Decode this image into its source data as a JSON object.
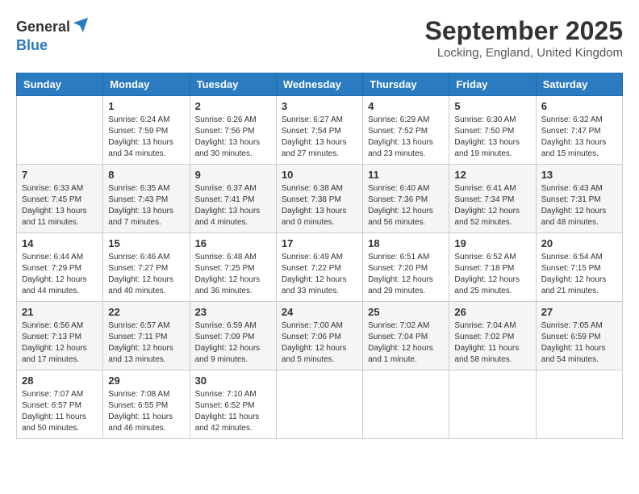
{
  "logo": {
    "general": "General",
    "blue": "Blue"
  },
  "title": "September 2025",
  "location": "Locking, England, United Kingdom",
  "weekdays": [
    "Sunday",
    "Monday",
    "Tuesday",
    "Wednesday",
    "Thursday",
    "Friday",
    "Saturday"
  ],
  "weeks": [
    [
      {
        "date": "",
        "info": ""
      },
      {
        "date": "1",
        "info": "Sunrise: 6:24 AM\nSunset: 7:59 PM\nDaylight: 13 hours\nand 34 minutes."
      },
      {
        "date": "2",
        "info": "Sunrise: 6:26 AM\nSunset: 7:56 PM\nDaylight: 13 hours\nand 30 minutes."
      },
      {
        "date": "3",
        "info": "Sunrise: 6:27 AM\nSunset: 7:54 PM\nDaylight: 13 hours\nand 27 minutes."
      },
      {
        "date": "4",
        "info": "Sunrise: 6:29 AM\nSunset: 7:52 PM\nDaylight: 13 hours\nand 23 minutes."
      },
      {
        "date": "5",
        "info": "Sunrise: 6:30 AM\nSunset: 7:50 PM\nDaylight: 13 hours\nand 19 minutes."
      },
      {
        "date": "6",
        "info": "Sunrise: 6:32 AM\nSunset: 7:47 PM\nDaylight: 13 hours\nand 15 minutes."
      }
    ],
    [
      {
        "date": "7",
        "info": "Sunrise: 6:33 AM\nSunset: 7:45 PM\nDaylight: 13 hours\nand 11 minutes."
      },
      {
        "date": "8",
        "info": "Sunrise: 6:35 AM\nSunset: 7:43 PM\nDaylight: 13 hours\nand 7 minutes."
      },
      {
        "date": "9",
        "info": "Sunrise: 6:37 AM\nSunset: 7:41 PM\nDaylight: 13 hours\nand 4 minutes."
      },
      {
        "date": "10",
        "info": "Sunrise: 6:38 AM\nSunset: 7:38 PM\nDaylight: 13 hours\nand 0 minutes."
      },
      {
        "date": "11",
        "info": "Sunrise: 6:40 AM\nSunset: 7:36 PM\nDaylight: 12 hours\nand 56 minutes."
      },
      {
        "date": "12",
        "info": "Sunrise: 6:41 AM\nSunset: 7:34 PM\nDaylight: 12 hours\nand 52 minutes."
      },
      {
        "date": "13",
        "info": "Sunrise: 6:43 AM\nSunset: 7:31 PM\nDaylight: 12 hours\nand 48 minutes."
      }
    ],
    [
      {
        "date": "14",
        "info": "Sunrise: 6:44 AM\nSunset: 7:29 PM\nDaylight: 12 hours\nand 44 minutes."
      },
      {
        "date": "15",
        "info": "Sunrise: 6:46 AM\nSunset: 7:27 PM\nDaylight: 12 hours\nand 40 minutes."
      },
      {
        "date": "16",
        "info": "Sunrise: 6:48 AM\nSunset: 7:25 PM\nDaylight: 12 hours\nand 36 minutes."
      },
      {
        "date": "17",
        "info": "Sunrise: 6:49 AM\nSunset: 7:22 PM\nDaylight: 12 hours\nand 33 minutes."
      },
      {
        "date": "18",
        "info": "Sunrise: 6:51 AM\nSunset: 7:20 PM\nDaylight: 12 hours\nand 29 minutes."
      },
      {
        "date": "19",
        "info": "Sunrise: 6:52 AM\nSunset: 7:18 PM\nDaylight: 12 hours\nand 25 minutes."
      },
      {
        "date": "20",
        "info": "Sunrise: 6:54 AM\nSunset: 7:15 PM\nDaylight: 12 hours\nand 21 minutes."
      }
    ],
    [
      {
        "date": "21",
        "info": "Sunrise: 6:56 AM\nSunset: 7:13 PM\nDaylight: 12 hours\nand 17 minutes."
      },
      {
        "date": "22",
        "info": "Sunrise: 6:57 AM\nSunset: 7:11 PM\nDaylight: 12 hours\nand 13 minutes."
      },
      {
        "date": "23",
        "info": "Sunrise: 6:59 AM\nSunset: 7:09 PM\nDaylight: 12 hours\nand 9 minutes."
      },
      {
        "date": "24",
        "info": "Sunrise: 7:00 AM\nSunset: 7:06 PM\nDaylight: 12 hours\nand 5 minutes."
      },
      {
        "date": "25",
        "info": "Sunrise: 7:02 AM\nSunset: 7:04 PM\nDaylight: 12 hours\nand 1 minute."
      },
      {
        "date": "26",
        "info": "Sunrise: 7:04 AM\nSunset: 7:02 PM\nDaylight: 11 hours\nand 58 minutes."
      },
      {
        "date": "27",
        "info": "Sunrise: 7:05 AM\nSunset: 6:59 PM\nDaylight: 11 hours\nand 54 minutes."
      }
    ],
    [
      {
        "date": "28",
        "info": "Sunrise: 7:07 AM\nSunset: 6:57 PM\nDaylight: 11 hours\nand 50 minutes."
      },
      {
        "date": "29",
        "info": "Sunrise: 7:08 AM\nSunset: 6:55 PM\nDaylight: 11 hours\nand 46 minutes."
      },
      {
        "date": "30",
        "info": "Sunrise: 7:10 AM\nSunset: 6:52 PM\nDaylight: 11 hours\nand 42 minutes."
      },
      {
        "date": "",
        "info": ""
      },
      {
        "date": "",
        "info": ""
      },
      {
        "date": "",
        "info": ""
      },
      {
        "date": "",
        "info": ""
      }
    ]
  ]
}
